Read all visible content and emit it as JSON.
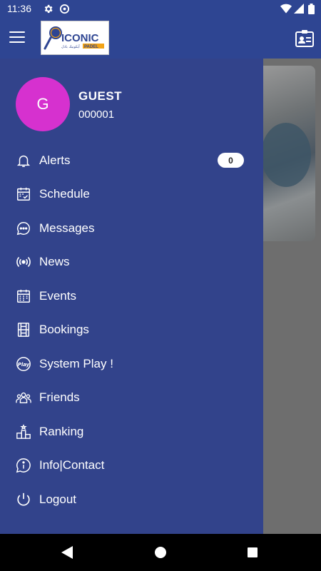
{
  "status_bar": {
    "time": "11:36"
  },
  "app_bar": {
    "logo": {
      "text": "ICONIC",
      "subtext": "PADEL",
      "arabic": "آيكونيك بادل"
    }
  },
  "drawer": {
    "user": {
      "initial": "G",
      "name": "GUEST",
      "id": "000001"
    },
    "items": [
      {
        "label": "Alerts",
        "icon": "bell-icon",
        "badge": "0"
      },
      {
        "label": "Schedule",
        "icon": "calendar-check-icon"
      },
      {
        "label": "Messages",
        "icon": "chat-bubble-icon"
      },
      {
        "label": "News",
        "icon": "broadcast-icon"
      },
      {
        "label": "Events",
        "icon": "calendar-grid-icon"
      },
      {
        "label": "Bookings",
        "icon": "court-icon"
      },
      {
        "label": "System Play !",
        "icon": "play-badge-icon"
      },
      {
        "label": "Friends",
        "icon": "friends-icon"
      },
      {
        "label": "Ranking",
        "icon": "podium-icon"
      },
      {
        "label": "Info|Contact",
        "icon": "info-icon"
      },
      {
        "label": "Logout",
        "icon": "power-icon"
      }
    ]
  },
  "colors": {
    "primary": "#2e4592",
    "drawer": "#32438b",
    "avatar": "#d631cf"
  }
}
